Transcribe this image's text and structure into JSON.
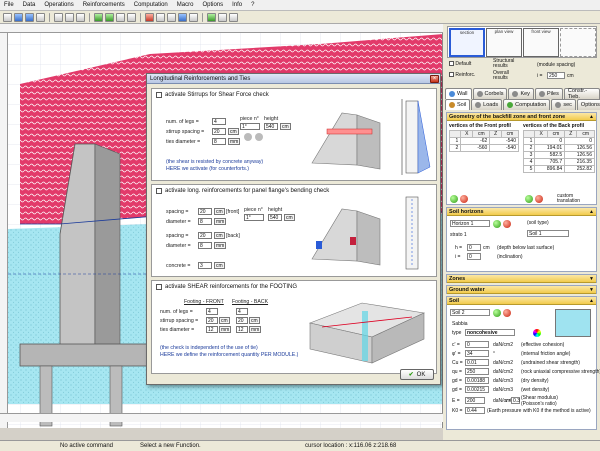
{
  "menu": [
    "File",
    "Data",
    "Operations",
    "Reinforcements",
    "Computation",
    "Macro",
    "Options",
    "Info",
    "?"
  ],
  "dialog": {
    "title": "Longitudinal Reinforcements and Ties",
    "shear": {
      "check_label": "activate Stirrups for Shear Force check",
      "num_legs_label": "num. of legs =",
      "num_legs": "4",
      "stirrup_spacing_label": "stirrup spacing =",
      "stirrup_spacing": "20",
      "ties_diameter_label": "ties diameter =",
      "ties_diameter": "8",
      "unit_cm": "cm",
      "unit_mm": "mm",
      "piece_label": "piece n°",
      "height_label": "height",
      "piece": "1°",
      "height": "540",
      "note1": "(the shear is resisted by concrete anyway)",
      "note2": "HERE we activate (for counterforts.)"
    },
    "flange": {
      "check_label": "activate long. reinforcements for panel flange's bending check",
      "spacing_label": "spacing =",
      "front_spacing": "20",
      "front_diameter": "8",
      "front_label": "[front]",
      "back_spacing": "20",
      "back_diameter": "8",
      "back_label": "[back]",
      "diameter_label": "diameter =",
      "piece_label": "piece n°",
      "height_label": "height",
      "piece": "1°",
      "height": "540",
      "concrete_label": "concrete =",
      "concrete": "3",
      "unit_cm": "cm",
      "unit_mm": "mm"
    },
    "footing": {
      "check_label": "activate SHEAR reinforcements for the FOOTING",
      "front_title": "Footing - FRONT",
      "back_title": "Footing - BACK",
      "num_legs_label": "num. of legs =",
      "stirrup_spacing_label": "stirrup spacing =",
      "ties_diameter_label": "ties diameter =",
      "front_legs": "4",
      "front_spacing": "20",
      "front_diameter": "12",
      "back_legs": "4",
      "back_spacing": "20",
      "back_diameter": "12",
      "unit_cm": "cm",
      "unit_mm": "mm",
      "note1": "(the check is independent of the use of tie)",
      "note2": "HERE we define the reinforcement quantity PER MODULE.)"
    },
    "ok_label": "OK"
  },
  "right": {
    "thumbs": [
      "section",
      "plan view",
      "front view"
    ],
    "default_label": "Default",
    "reinforc_label": "Reinforc.",
    "structural_label": "Structural results",
    "overall_label": "Overall results",
    "module_label": "(module spacing)",
    "i_label": "i =",
    "i_value": "250",
    "i_unit": "cm",
    "tabs1": [
      "Wall",
      "Corbels",
      "Key",
      "Piles",
      "Constr.-Tieb."
    ],
    "tabs2": [
      "Soil",
      "Loads",
      "Computation",
      "sec",
      "Options"
    ],
    "geom_title": "Geometry of the backfill zone and front zone",
    "front_profile_title": "vertices of the Front profil",
    "back_profile_title": "vertices of the Back profil",
    "front_cols": [
      "",
      "X",
      "cm",
      "Z",
      "cm"
    ],
    "back_cols": [
      "",
      "X",
      "cm",
      "Z",
      "cm"
    ],
    "front_rows": [
      [
        "1",
        "-62",
        "-540"
      ],
      [
        "2",
        "-560",
        "-540"
      ]
    ],
    "back_rows": [
      [
        "1",
        "0",
        "0"
      ],
      [
        "2",
        "194.01",
        "126.56"
      ],
      [
        "3",
        "582.5",
        "126.56"
      ],
      [
        "4",
        "705.7",
        "216.35"
      ],
      [
        "5",
        "896.84",
        "252.82"
      ]
    ],
    "custom_label": "custom translation",
    "soil_horizons_title": "Soil horizons",
    "horizon_select": "Horizon 1",
    "strato_label": "strato 1",
    "soil_type_label": "(soil type)",
    "soil_select": "Soil 1",
    "h_label": "h =",
    "h_value": "0",
    "h_unit": "cm",
    "h_desc": "(depth below last surface)",
    "i2_label": "i =",
    "i2_value": "0",
    "i2_desc": "(inclination)",
    "zones_title": "Zones",
    "groundwater_title": "Ground water",
    "soil_title": "Soil",
    "soil2_select": "Soil 2",
    "soil_name": "Sabbia",
    "type_label": "type",
    "type_value": "noncohesive",
    "c_label": "c' =",
    "c_value": "0",
    "c_unit": "daN/cm2",
    "c_desc": "(effective cohesion)",
    "phi_label": "φ' =",
    "phi_value": "34",
    "phi_unit": "°",
    "phi_desc": "(internal friction angle)",
    "cu_label": "Cu =",
    "cu_value": "0.01",
    "cu_unit": "daN/cm2",
    "cu_desc": "(undrained shear strength)",
    "qu_label": "qu =",
    "qu_value": "250",
    "qu_unit": "daN/cm2",
    "qu_desc": "(rock uniaxial compressive strength)",
    "gd_label": "gd =",
    "gd_value": "0.00188",
    "gd_unit": "daN/cm3",
    "gd_desc": "(dry density)",
    "gs_label": "gd =",
    "gs_value": "0.00215",
    "gs_unit": "daN/cm3",
    "gs_desc": "(wet density)",
    "e_label": "E =",
    "e_value": "200",
    "e_unit": "daN/cm2",
    "nu_label": "v =",
    "nu_value": "0.3",
    "e_desc": "(Shear modulus)",
    "nu_desc": "(Poisson's ratio)",
    "k0_label": "K0 =",
    "k0_value": "0.44",
    "k0_desc": "(Earth pressure with K0 if the method is active)"
  },
  "status": {
    "left": "No active command",
    "mid": "Select a new Function.",
    "cursor": "cursor location : x:116.06  z:218.68"
  },
  "colors": {
    "hatch": "#e23a6a",
    "soil_front": "#9fe3f0",
    "concrete": "#b8b8b8",
    "accent": "#2a5bd7"
  }
}
